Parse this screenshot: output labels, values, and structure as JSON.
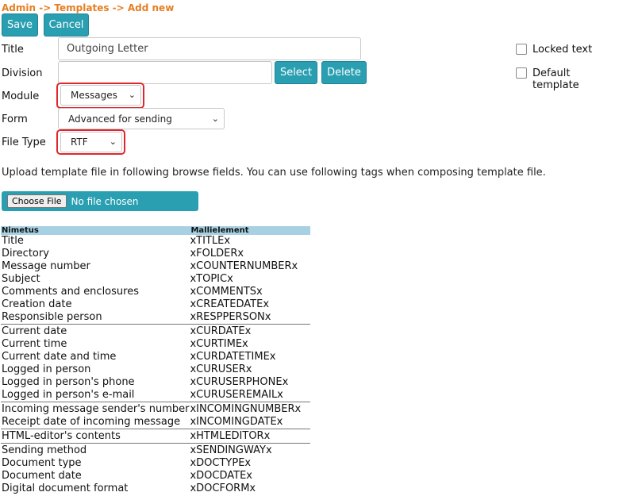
{
  "breadcrumb": "Admin -> Templates -> Add new",
  "toolbar": {
    "save_label": "Save",
    "cancel_label": "Cancel"
  },
  "form": {
    "title_label": "Title",
    "title_value": "Outgoing Letter",
    "division_label": "Division",
    "division_value": "",
    "select_label": "Select",
    "delete_label": "Delete",
    "module_label": "Module",
    "module_value": "Messages",
    "form_label": "Form",
    "form_value": "Advanced for sending",
    "filetype_label": "File Type",
    "filetype_value": "RTF",
    "locked_text_label": "Locked text",
    "default_template_label": "Default template",
    "locked_text_checked": false,
    "default_template_checked": false
  },
  "highlight_color": "#e0262c",
  "accent_color": "#2a9fb1",
  "upload": {
    "info": "Upload template file in following browse fields. You can use following tags when composing template file.",
    "choose_label": "Choose File",
    "no_file_text": "No file chosen"
  },
  "tags_table": {
    "headers": [
      "Nimetus",
      "Mallielement"
    ],
    "groups": [
      [
        [
          "Title",
          "xTITLEx"
        ],
        [
          "Directory",
          "xFOLDERx"
        ],
        [
          "Message number",
          "xCOUNTERNUMBERx"
        ],
        [
          "Subject",
          "xTOPICx"
        ],
        [
          "Comments and enclosures",
          "xCOMMENTSx"
        ],
        [
          "Creation date",
          "xCREATEDATEx"
        ],
        [
          "Responsible person",
          "xRESPPERSONx"
        ]
      ],
      [
        [
          "Current date",
          "xCURDATEx"
        ],
        [
          "Current time",
          "xCURTIMEx"
        ],
        [
          "Current date and time",
          "xCURDATETIMEx"
        ],
        [
          "Logged in person",
          "xCURUSERx"
        ],
        [
          "Logged in person's phone",
          "xCURUSERPHONEx"
        ],
        [
          "Logged in person's e-mail",
          "xCURUSEREMAILx"
        ]
      ],
      [
        [
          "Incoming message sender's number",
          "xINCOMINGNUMBERx"
        ],
        [
          "Receipt date of incoming message",
          "xINCOMINGDATEx"
        ]
      ],
      [
        [
          "HTML-editor's contents",
          "xHTMLEDITORx"
        ]
      ],
      [
        [
          "Sending method",
          "xSENDINGWAYx"
        ],
        [
          "Document type",
          "xDOCTYPEx"
        ],
        [
          "Document date",
          "xDOCDATEx"
        ],
        [
          "Digital document format",
          "xDOCFORMx"
        ]
      ]
    ]
  }
}
